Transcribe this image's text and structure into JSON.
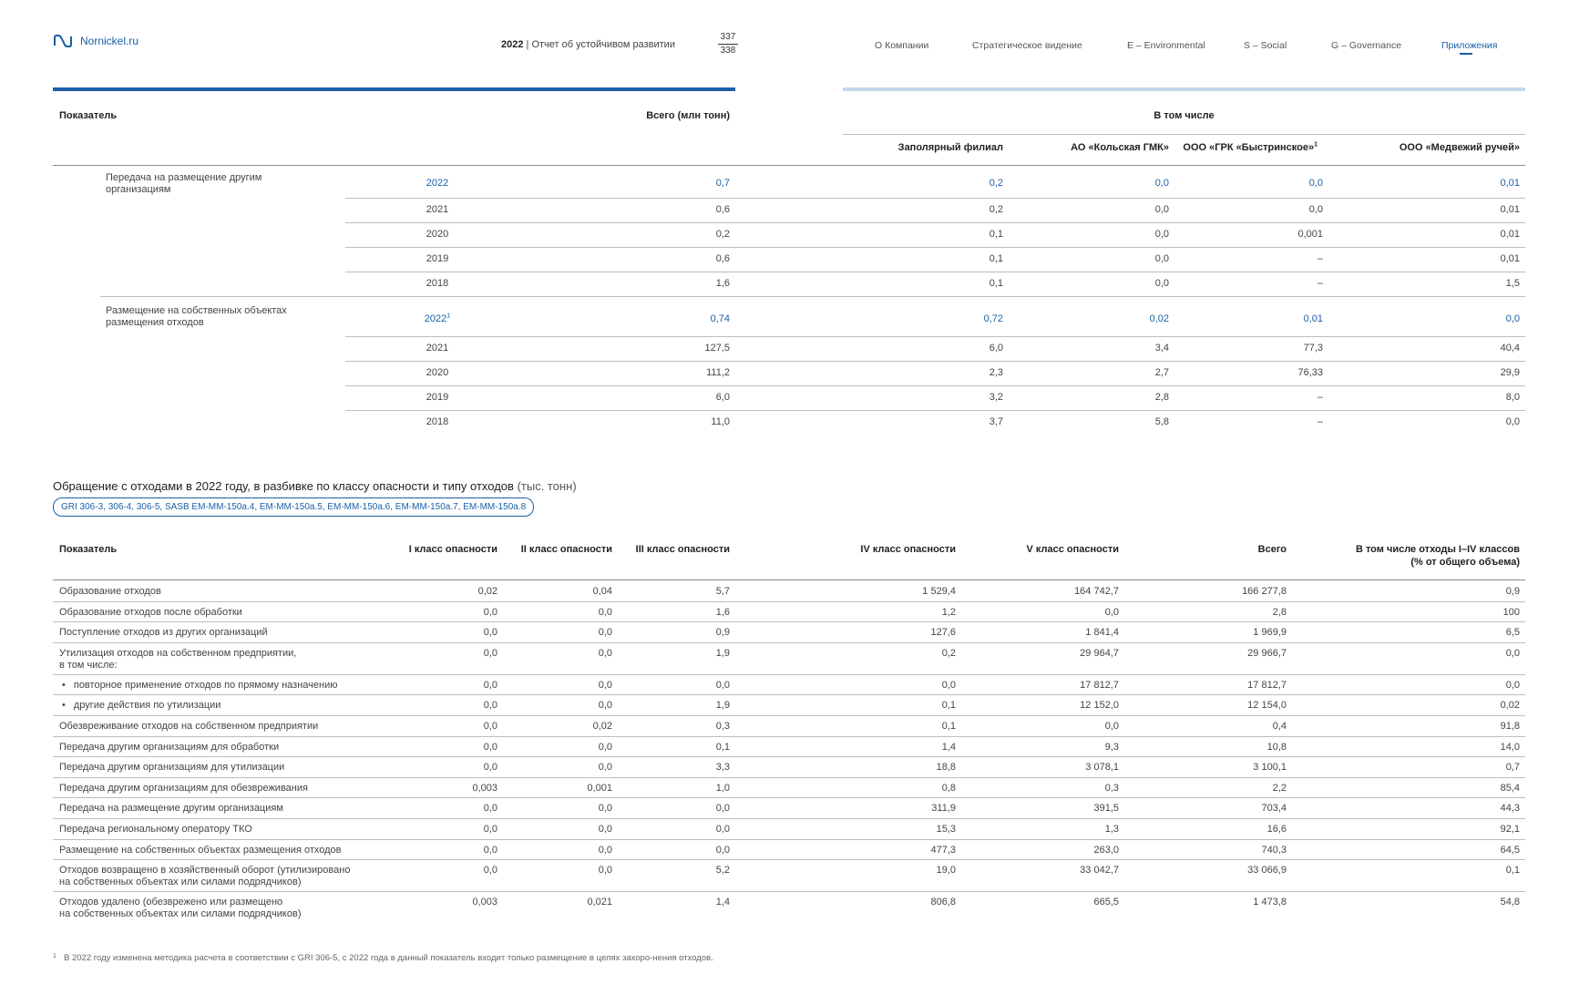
{
  "header": {
    "logo_text": "Nornickel.ru",
    "report_year": "2022",
    "report_title": "Отчет об устойчивом развитии",
    "page_current": "337",
    "page_total": "338",
    "nav": [
      "О Компании",
      "Стратегическое видение",
      "E – Environmental",
      "S – Social",
      "G – Governance",
      "Приложения"
    ],
    "nav_active": "Приложения",
    "colors": {
      "accent": "#1a5fa8",
      "accent_light": "#c5d7e8"
    }
  },
  "table1": {
    "header": {
      "indicator": "Показатель",
      "total": "Всего (млн тонн)",
      "including": "В том числе",
      "subsidiaries": [
        "Заполярный филиал",
        "АО «Кольская ГМК»",
        "ООО «ГРК «Быстринское»",
        "ООО «Медвежий ручей»"
      ],
      "footnote_mark": "1"
    },
    "groups": [
      {
        "label": "Передача на размещение другим организациям",
        "rows": [
          {
            "year": "2022",
            "year_mark": "",
            "values": [
              "0,7",
              "0,2",
              "0,0",
              "0,0",
              "0,01"
            ]
          },
          {
            "year": "2021",
            "year_mark": "",
            "values": [
              "0,6",
              "0,2",
              "0,0",
              "0,0",
              "0,01"
            ]
          },
          {
            "year": "2020",
            "year_mark": "",
            "values": [
              "0,2",
              "0,1",
              "0,0",
              "0,001",
              "0,01"
            ]
          },
          {
            "year": "2019",
            "year_mark": "",
            "values": [
              "0,6",
              "0,1",
              "0,0",
              "–",
              "0,01"
            ]
          },
          {
            "year": "2018",
            "year_mark": "",
            "values": [
              "1,6",
              "0,1",
              "0,0",
              "–",
              "1,5"
            ]
          }
        ]
      },
      {
        "label": "Размещение на собственных объектах размещения отходов",
        "rows": [
          {
            "year": "2022",
            "year_mark": "1",
            "values": [
              "0,74",
              "0,72",
              "0,02",
              "0,01",
              "0,0"
            ]
          },
          {
            "year": "2021",
            "year_mark": "",
            "values": [
              "127,5",
              "6,0",
              "3,4",
              "77,3",
              "40,4"
            ]
          },
          {
            "year": "2020",
            "year_mark": "",
            "values": [
              "111,2",
              "2,3",
              "2,7",
              "76,33",
              "29,9"
            ]
          },
          {
            "year": "2019",
            "year_mark": "",
            "values": [
              "6,0",
              "3,2",
              "2,8",
              "–",
              "8,0"
            ]
          },
          {
            "year": "2018",
            "year_mark": "",
            "values": [
              "11,0",
              "3,7",
              "5,8",
              "–",
              "0,0"
            ]
          }
        ]
      }
    ]
  },
  "section2": {
    "title": "Обращение с отходами в 2022 году, в разбивке по классу опасности и типу отходов",
    "unit": "(тыс. тонн)",
    "gri_tag": "GRI 306-3, 306-4, 306-5, SASB EM-MM-150a.4, EM-MM-150a.5, EM-MM-150a.6, EM-MM-150a.7, EM-MM-150a.8",
    "columns": [
      "Показатель",
      "I класс опасности",
      "II класс опасности",
      "III класс опасности",
      "IV класс опасности",
      "V класс опасности",
      "Всего",
      "В том числе отходы I–IV классов",
      "(% от общего объема)"
    ],
    "rows": [
      {
        "label": [
          "Образование отходов"
        ],
        "bullet": false,
        "values": [
          "0,02",
          "0,04",
          "5,7",
          "1 529,4",
          "164 742,7",
          "166 277,8",
          "0,9"
        ]
      },
      {
        "label": [
          "Образование отходов после обработки"
        ],
        "bullet": false,
        "values": [
          "0,0",
          "0,0",
          "1,6",
          "1,2",
          "0,0",
          "2,8",
          "100"
        ]
      },
      {
        "label": [
          "Поступление отходов из других организаций"
        ],
        "bullet": false,
        "values": [
          "0,0",
          "0,0",
          "0,9",
          "127,6",
          "1 841,4",
          "1 969,9",
          "6,5"
        ]
      },
      {
        "label": [
          "Утилизация отходов на собственном предприятии,",
          "в том числе:"
        ],
        "bullet": false,
        "values": [
          "0,0",
          "0,0",
          "1,9",
          "0,2",
          "29 964,7",
          "29 966,7",
          "0,0"
        ]
      },
      {
        "label": [
          "повторное применение отходов по прямому назначению"
        ],
        "bullet": true,
        "values": [
          "0,0",
          "0,0",
          "0,0",
          "0,0",
          "17 812,7",
          "17 812,7",
          "0,0"
        ]
      },
      {
        "label": [
          "другие действия по утилизации"
        ],
        "bullet": true,
        "values": [
          "0,0",
          "0,0",
          "1,9",
          "0,1",
          "12 152,0",
          "12 154,0",
          "0,02"
        ]
      },
      {
        "label": [
          "Обезвреживание отходов на собственном предприятии"
        ],
        "bullet": false,
        "values": [
          "0,0",
          "0,02",
          "0,3",
          "0,1",
          "0,0",
          "0,4",
          "91,8"
        ]
      },
      {
        "label": [
          "Передача другим организациям для обработки"
        ],
        "bullet": false,
        "values": [
          "0,0",
          "0,0",
          "0,1",
          "1,4",
          "9,3",
          "10,8",
          "14,0"
        ]
      },
      {
        "label": [
          "Передача другим организациям для утилизации"
        ],
        "bullet": false,
        "values": [
          "0,0",
          "0,0",
          "3,3",
          "18,8",
          "3 078,1",
          "3 100,1",
          "0,7"
        ]
      },
      {
        "label": [
          "Передача другим организациям для обезвреживания"
        ],
        "bullet": false,
        "values": [
          "0,003",
          "0,001",
          "1,0",
          "0,8",
          "0,3",
          "2,2",
          "85,4"
        ]
      },
      {
        "label": [
          "Передача на размещение другим организациям"
        ],
        "bullet": false,
        "values": [
          "0,0",
          "0,0",
          "0,0",
          "311,9",
          "391,5",
          "703,4",
          "44,3"
        ]
      },
      {
        "label": [
          "Передача региональному оператору ТКО"
        ],
        "bullet": false,
        "values": [
          "0,0",
          "0,0",
          "0,0",
          "15,3",
          "1,3",
          "16,6",
          "92,1"
        ]
      },
      {
        "label": [
          "Размещение на собственных объектах размещения отходов"
        ],
        "bullet": false,
        "values": [
          "0,0",
          "0,0",
          "0,0",
          "477,3",
          "263,0",
          "740,3",
          "64,5"
        ]
      },
      {
        "label": [
          "Отходов возвращено в хозяйственный оборот (утилизировано",
          "на собственных объектах или силами подрядчиков)"
        ],
        "bullet": false,
        "values": [
          "0,0",
          "0,0",
          "5,2",
          "19,0",
          "33 042,7",
          "33 066,9",
          "0,1"
        ]
      },
      {
        "label": [
          "Отходов удалено (обезврежено или размещено",
          "на собственных объектах или силами подрядчиков)"
        ],
        "bullet": false,
        "values": [
          "0,003",
          "0,021",
          "1,4",
          "806,8",
          "665,5",
          "1 473,8",
          "54,8"
        ]
      }
    ]
  },
  "footnote": {
    "mark": "1",
    "text": "В 2022 году изменена методика расчета в соответствии с GRI 306-5, с 2022 года в данный показатель входит только размещение в целях захоро-нения отходов."
  }
}
